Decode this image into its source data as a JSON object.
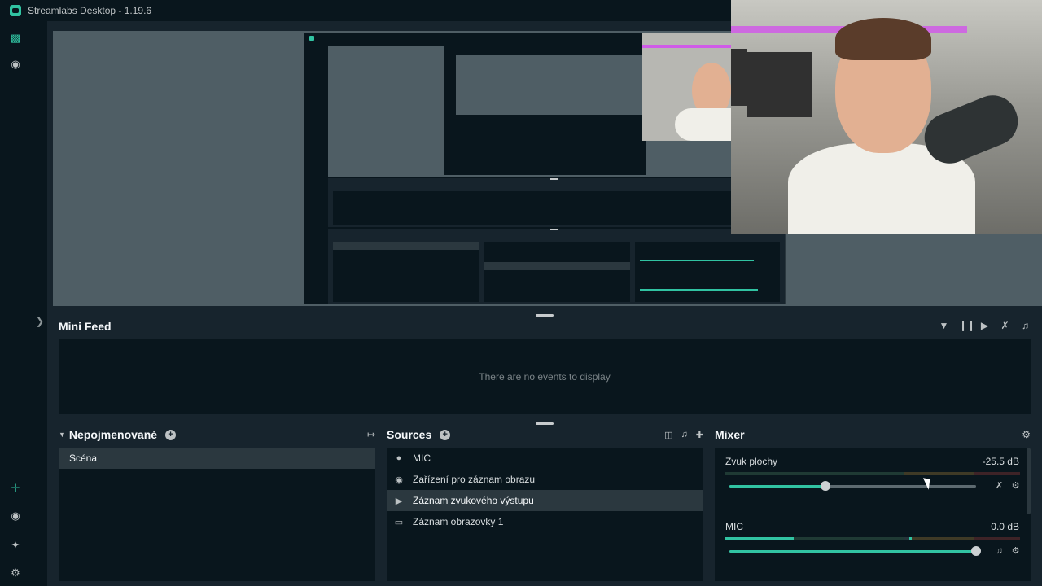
{
  "app": {
    "title": "Streamlabs Desktop - 1.19.6"
  },
  "nav": {
    "icons": [
      "editor-icon",
      "record-icon",
      "add-app-icon",
      "app-store-icon",
      "highlighter-icon",
      "settings-icon"
    ]
  },
  "mini_feed": {
    "title": "Mini Feed",
    "empty_text": "There are no events to display",
    "controls": [
      "filter-icon",
      "pause-icon",
      "skip-icon",
      "mute-alerts-icon",
      "volume-icon"
    ]
  },
  "scenes": {
    "title": "Nepojmenované",
    "items": [
      "Scéna"
    ]
  },
  "sources": {
    "title": "Sources",
    "items": [
      {
        "label": "MIC",
        "icon": "microphone-icon"
      },
      {
        "label": "Zařízení pro záznam obrazu",
        "icon": "webcam-icon"
      },
      {
        "label": "Záznam zvukového výstupu",
        "icon": "speaker-icon"
      },
      {
        "label": "Záznam obrazovky 1",
        "icon": "monitor-icon"
      }
    ]
  },
  "mixer": {
    "title": "Mixer",
    "channels": [
      {
        "name": "Zvuk plochy",
        "db": "-25.5 dB",
        "volume": 0.39,
        "muted": true
      },
      {
        "name": "MIC",
        "db": "0.0 dB",
        "volume": 1.0,
        "muted": false
      }
    ]
  },
  "colors": {
    "accent": "#31c3a2",
    "background": "#09161d",
    "panel": "#17242d",
    "preview": "#4f5e65"
  }
}
